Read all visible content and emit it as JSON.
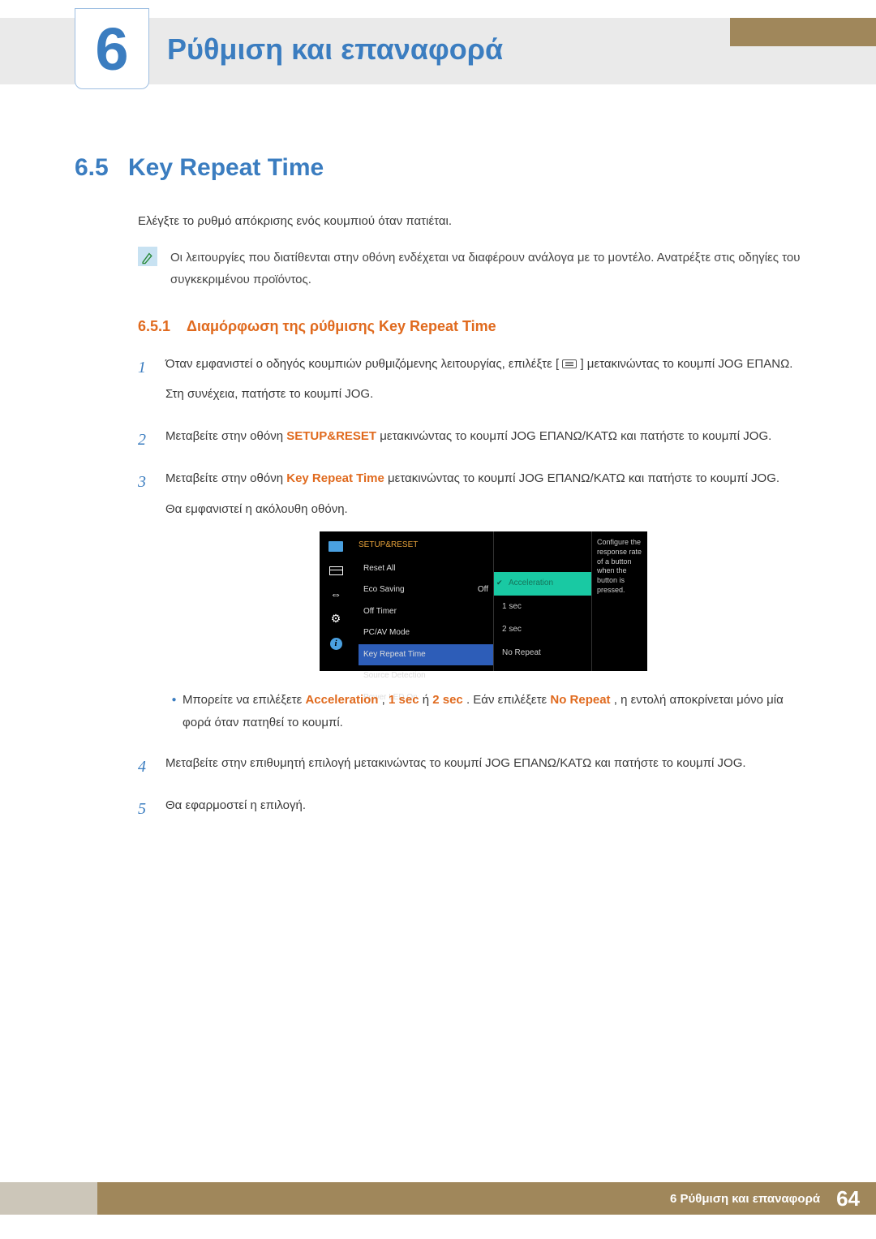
{
  "chapter": {
    "number": "6",
    "title": "Ρύθμιση και επαναφορά"
  },
  "section": {
    "number": "6.5",
    "title": "Key Repeat Time",
    "intro": "Ελέγξτε το ρυθμό απόκρισης ενός κουμπιού όταν πατιέται.",
    "note": "Οι λειτουργίες που διατίθενται στην οθόνη ενδέχεται να διαφέρουν ανάλογα με το μοντέλο. Ανατρέξτε στις οδηγίες του συγκεκριμένου προϊόντος."
  },
  "subsection": {
    "number": "6.5.1",
    "title": "Διαμόρφωση της ρύθμισης Key Repeat Time"
  },
  "steps": {
    "s1a_pre": "Όταν εμφανιστεί ο οδηγός κουμπιών ρυθμιζόμενης λειτουργίας, επιλέξτε [",
    "s1a_post": "] μετακινώντας το κουμπί JOG ΕΠΑΝΩ.",
    "s1b": "Στη συνέχεια, πατήστε το κουμπί JOG.",
    "s2_pre": "Μεταβείτε στην οθόνη ",
    "s2_hl": "SETUP&RESET",
    "s2_post": " μετακινώντας το κουμπί JOG ΕΠΑΝΩ/ΚΑΤΩ και πατήστε το κουμπί JOG.",
    "s3_pre": "Μεταβείτε στην οθόνη ",
    "s3_hl": "Key Repeat Time",
    "s3_post": " μετακινώντας το κουμπί JOG ΕΠΑΝΩ/ΚΑΤΩ και πατήστε το κουμπί JOG.",
    "s3b": "Θα εμφανιστεί η ακόλουθη οθόνη.",
    "bullet_pre": "Μπορείτε να επιλέξετε ",
    "bullet_h1": "Acceleration",
    "bullet_c1": ", ",
    "bullet_h2": "1 sec",
    "bullet_c2": " ή ",
    "bullet_h3": "2 sec",
    "bullet_c3": ". Εάν επιλέξετε ",
    "bullet_h4": "No Repeat",
    "bullet_post": ", η εντολή αποκρίνεται μόνο μία φορά όταν πατηθεί το κουμπί.",
    "s4": "Μεταβείτε στην επιθυμητή επιλογή μετακινώντας το κουμπί JOG ΕΠΑΝΩ/ΚΑΤΩ και πατήστε το κουμπί JOG.",
    "s5": "Θα εφαρμοστεί η επιλογή."
  },
  "osd": {
    "header": "SETUP&RESET",
    "items": [
      {
        "label": "Reset All",
        "value": ""
      },
      {
        "label": "Eco Saving",
        "value": "Off"
      },
      {
        "label": "Off Timer",
        "value": ""
      },
      {
        "label": "PC/AV Mode",
        "value": ""
      },
      {
        "label": "Key Repeat Time",
        "value": "",
        "selected": true
      },
      {
        "label": "Source Detection",
        "value": ""
      },
      {
        "label": "Power LED On",
        "value": ""
      }
    ],
    "sub": [
      {
        "label": "Acceleration",
        "selected": true
      },
      {
        "label": "1 sec"
      },
      {
        "label": "2 sec"
      },
      {
        "label": "No Repeat"
      }
    ],
    "desc": "Configure the response rate of a button when the button is pressed."
  },
  "footer": {
    "text": "6 Ρύθμιση και επαναφορά",
    "page": "64"
  }
}
